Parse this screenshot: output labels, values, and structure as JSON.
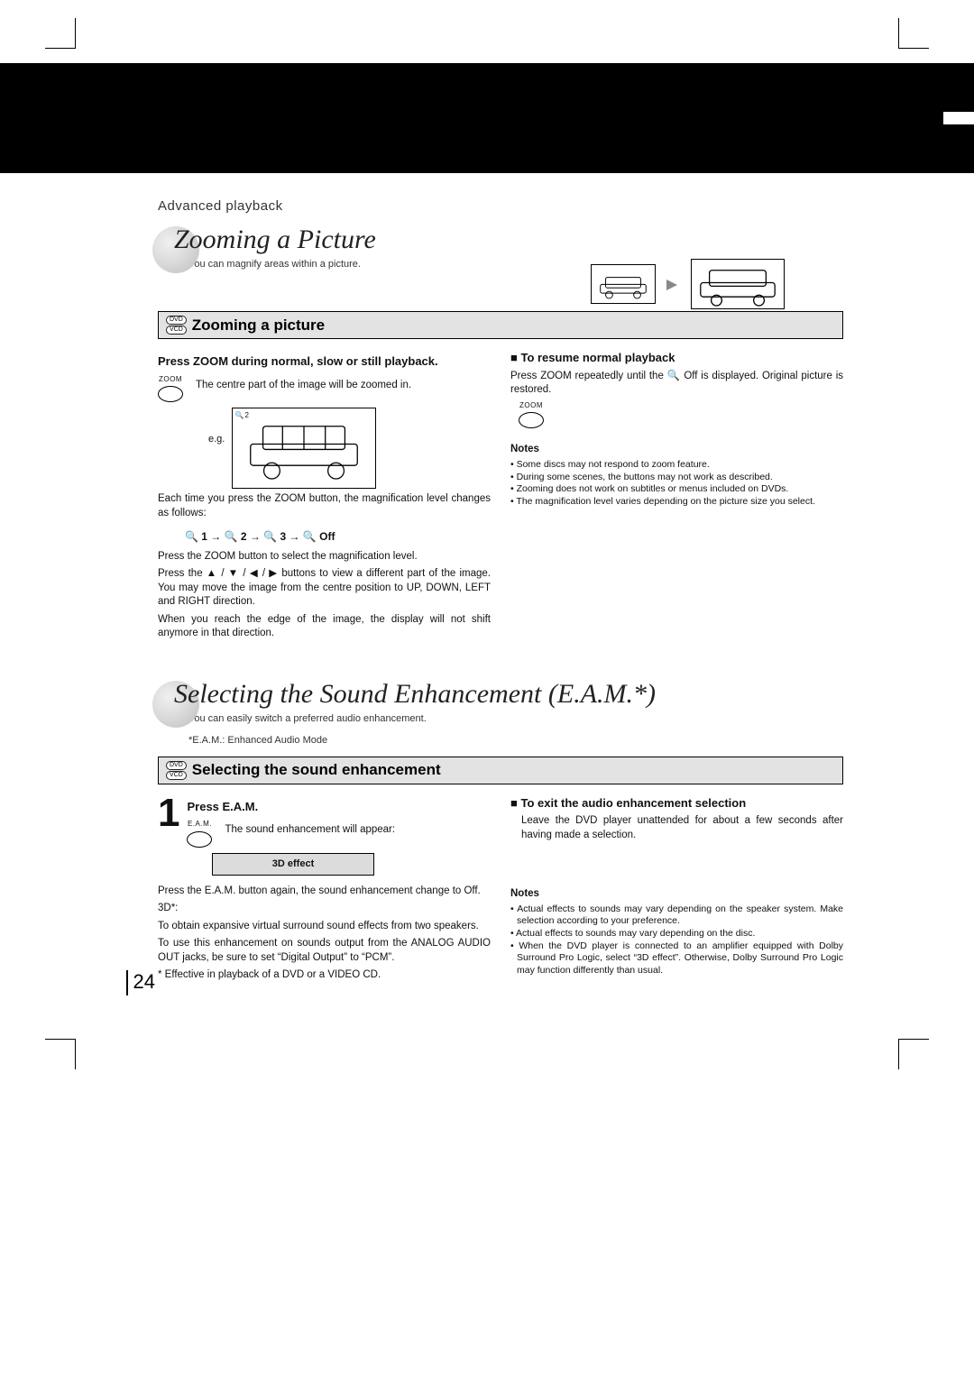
{
  "breadcrumb": "Advanced playback",
  "page_number": "24",
  "zoom": {
    "title": "Zooming a Picture",
    "subtitle": "You can magnify areas within a picture.",
    "bar_heading": "Zooming a picture",
    "format_badges": [
      "DVD",
      "VCD"
    ],
    "step_title": "Press ZOOM during normal, slow or still playback.",
    "btn_label": "ZOOM",
    "step_desc": "The centre part of the image will be zoomed in.",
    "eg_label": "e.g.",
    "eg_tag": "2",
    "seq": "🔍 1   →   🔍 2   →   🔍 3   → 🔍 Off",
    "p_each": "Each time you press the ZOOM button, the magnification level changes as follows:",
    "p_select": "Press the ZOOM button to select the magnification level.",
    "p_arrows": "Press the ▲ / ▼ / ◀ / ▶ buttons to view a different part of the image. You may move the image from the centre position to UP, DOWN, LEFT and RIGHT direction.",
    "p_edge": "When you reach the edge of the image, the display will not shift anymore in that direction.",
    "resume_hd": "To resume normal playback",
    "resume_p": "Press ZOOM repeatedly until the 🔍 Off is displayed. Original picture is restored.",
    "notes_hd": "Notes",
    "notes": [
      "Some discs may not respond to zoom feature.",
      "During some scenes, the buttons may not work as described.",
      "Zooming does not work on subtitles or menus included on DVDs.",
      "The magnification level varies depending on the picture size you select."
    ]
  },
  "eam": {
    "title": "Selecting the Sound Enhancement (E.A.M.*)",
    "subtitle": "You can easily switch a preferred audio enhancement.",
    "footnote": "*E.A.M.: Enhanced Audio Mode",
    "bar_heading": "Selecting the sound enhancement",
    "format_badges": [
      "DVD",
      "VCD"
    ],
    "step_num": "1",
    "step_title": "Press E.A.M.",
    "btn_label": "E.A.M.",
    "step_desc": "The sound enhancement will appear:",
    "osd": "3D effect",
    "p_again": "Press the E.A.M. button again, the sound enhancement change to Off.",
    "p_3d_label": "3D*:",
    "p_3d": "To obtain expansive virtual surround sound effects from two speakers.",
    "p_pcm": "To use this enhancement on sounds output from the ANALOG AUDIO OUT jacks, be sure to set “Digital Output” to “PCM”.",
    "p_eff": "* Effective in playback of a DVD or a VIDEO CD.",
    "exit_hd": "To exit the audio enhancement selection",
    "exit_p": "Leave the DVD player unattended for about a few seconds after having made a selection.",
    "notes_hd": "Notes",
    "notes": [
      "Actual effects to sounds may vary depending on the speaker system. Make selection according to your preference.",
      "Actual effects to sounds may vary depending on the disc.",
      "When the DVD player is connected to an amplifier equipped with Dolby Surround Pro Logic, select “3D effect”. Otherwise, Dolby Surround Pro Logic may function differently than usual."
    ]
  }
}
